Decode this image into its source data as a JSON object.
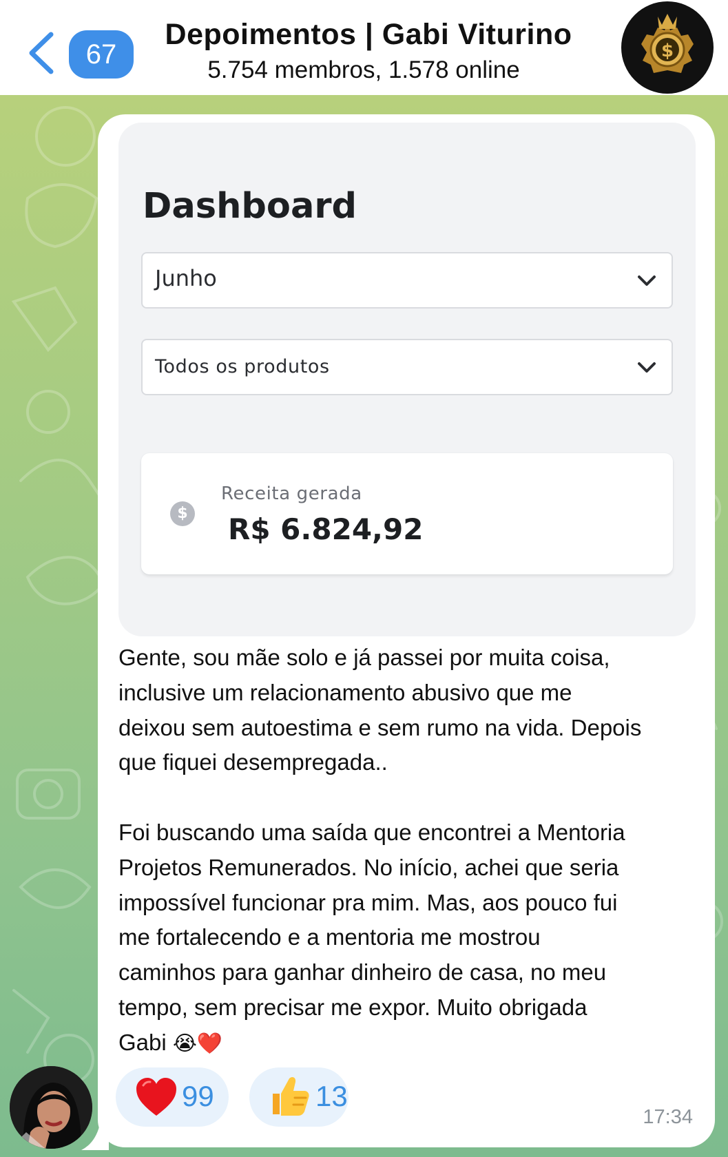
{
  "header": {
    "unread_count": "67",
    "title": "Depoimentos | Gabi Viturino",
    "subtitle": "5.754 membros, 1.578 online",
    "back_icon": "chevron-left-icon",
    "avatar_icon": "dollar-shield-logo"
  },
  "message": {
    "dashboard": {
      "title": "Dashboard",
      "month_select": "Junho",
      "product_select": "Todos os produtos",
      "revenue_label": "Receita gerada",
      "revenue_value": "R$ 6.824,92"
    },
    "text_part1": "Gente, sou mãe solo e já passei por muita coisa,\ninclusive um relacionamento abusivo que me\ndeixou sem autoestima e sem rumo na vida. Depois\nque fiquei desempregada..\n\nFoi buscando uma saída que encontrei a Mentoria\nProjetos Remunerados. No início, achei que seria\nimpossível funcionar pra mim. Mas, aos pouco fui\nme fortalecendo e a mentoria me mostrou\ncaminhos para ganhar dinheiro de casa, no meu\ntempo, sem precisar me expor. Muito obrigada\nGabi ",
    "text_emojis": "😭❤️",
    "reactions": [
      {
        "icon": "heart-icon",
        "count": "99"
      },
      {
        "icon": "thumbs-up-icon",
        "count": "13"
      }
    ],
    "time": "17:34"
  },
  "colors": {
    "accent": "#3f8fe8",
    "reaction_bg": "#e8f2fc",
    "reaction_text": "#3b8fe0"
  }
}
